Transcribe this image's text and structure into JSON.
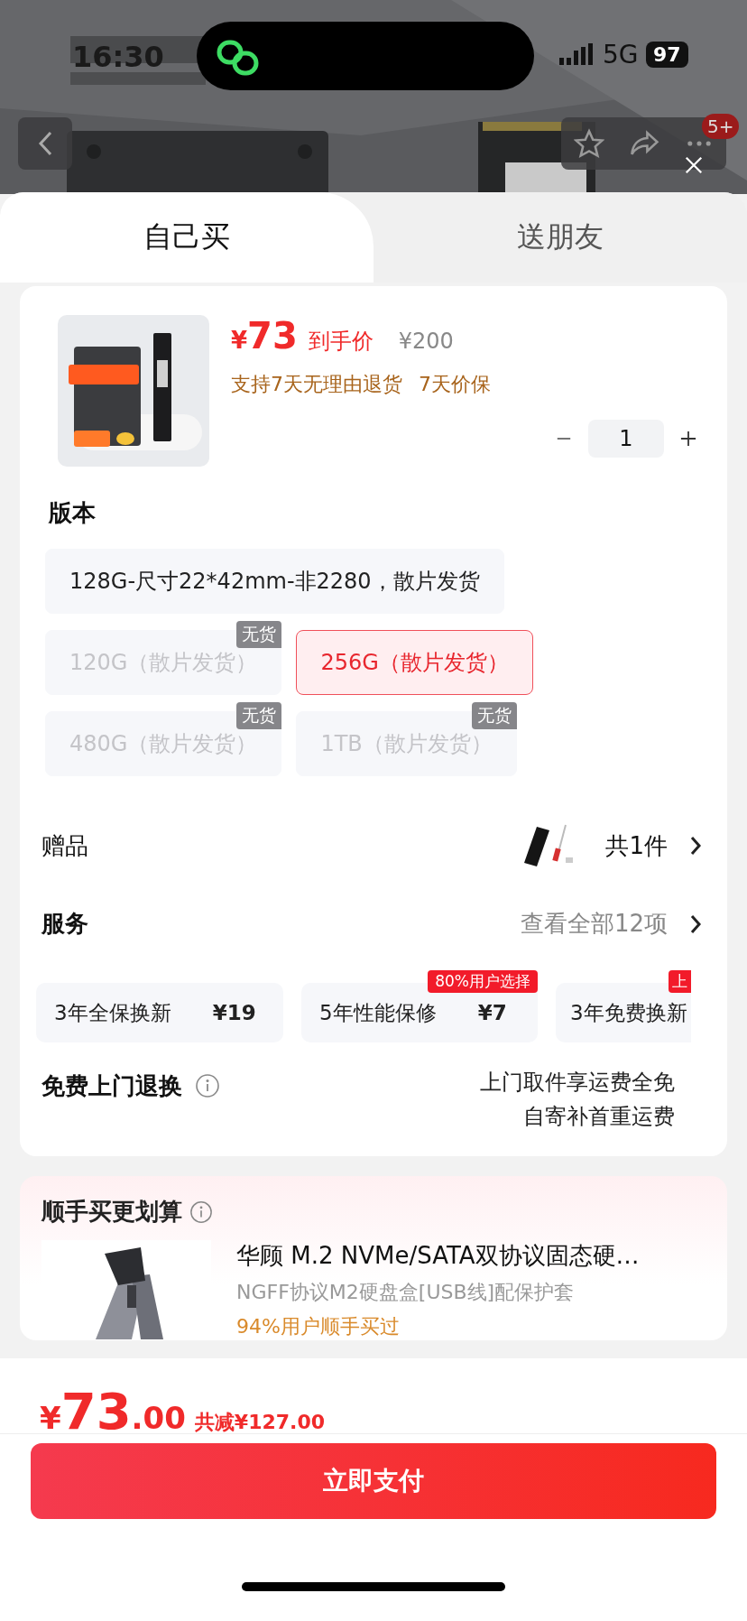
{
  "status_bar": {
    "time": "16:30",
    "network": "5G",
    "battery": "97"
  },
  "header": {
    "more_badge": "5+"
  },
  "tabs": [
    {
      "label": "自己买",
      "selected": true
    },
    {
      "label": "送朋友",
      "selected": false
    }
  ],
  "product": {
    "currency": "¥",
    "price": "73",
    "price_label": "到手价",
    "original_price": "¥200",
    "promos": [
      "支持7天无理由退货",
      "7天价保"
    ],
    "quantity": "1"
  },
  "version": {
    "title": "版本",
    "options": [
      {
        "label": "128G-尺寸22*42mm-非2280，散片发货",
        "selected": false,
        "disabled": false,
        "kind": "wide"
      },
      {
        "label": "120G（散片发货）",
        "selected": false,
        "disabled": true,
        "badge": "无货",
        "kind": "half"
      },
      {
        "label": "256G（散片发货）",
        "selected": true,
        "disabled": false,
        "kind": "half"
      },
      {
        "label": "480G（散片发货）",
        "selected": false,
        "disabled": true,
        "badge": "无货",
        "kind": "half"
      },
      {
        "label": "1TB（散片发货）",
        "selected": false,
        "disabled": true,
        "badge": "无货",
        "kind": "half"
      }
    ]
  },
  "gift": {
    "label": "赠品",
    "count": "共1件"
  },
  "services": {
    "title": "服务",
    "view_all": "查看全部12项",
    "items": [
      {
        "name": "3年全保换新",
        "price": "¥19"
      },
      {
        "name": "5年性能保修",
        "price": "¥7",
        "badge": "80%用户选择"
      },
      {
        "name": "3年免费换新",
        "badge": "上"
      }
    ]
  },
  "free_return": {
    "title": "免费上门退换",
    "lines": [
      "上门取件享运费全免",
      "自寄补首重运费"
    ]
  },
  "bundle": {
    "title": "顺手买更划算",
    "items": [
      {
        "title": "华顾 M.2 NVMe/SATA双协议固态硬…",
        "subtitle": "NGFF协议M2硬盘盒[USB线]配保护套",
        "note": "94%用户顺手买过"
      }
    ]
  },
  "footer": {
    "currency": "¥",
    "amount": "73",
    "decimals": ".00",
    "discount": "共减¥127.00",
    "pay_button": "立即支付"
  }
}
